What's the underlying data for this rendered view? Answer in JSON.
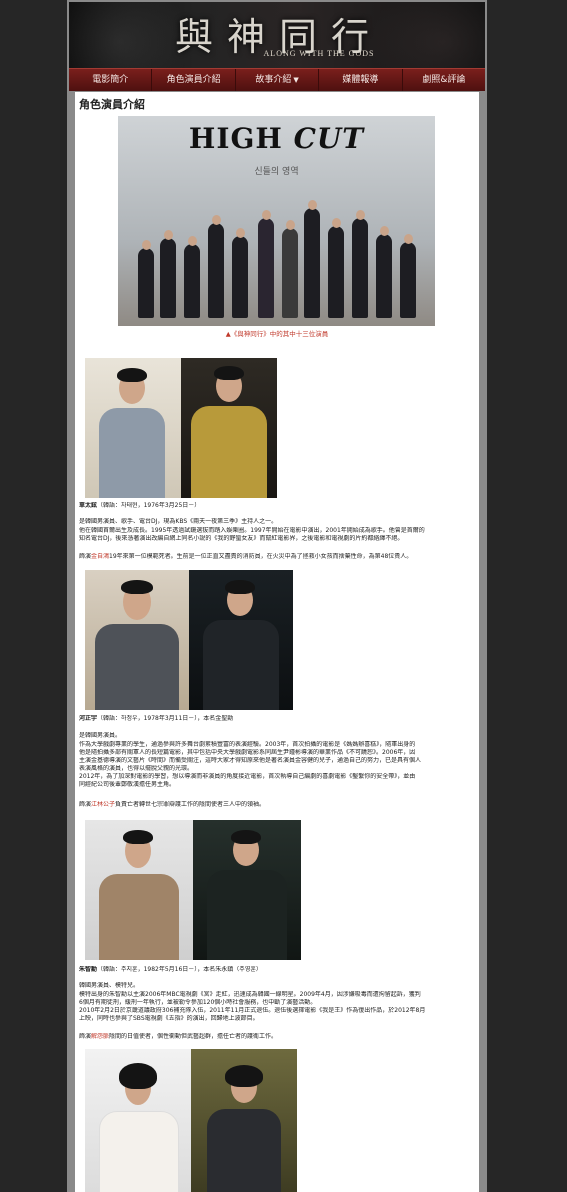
{
  "banner": {
    "title": "與神同行",
    "subtitle": "ALONG WITH THE GODS"
  },
  "nav": {
    "items": [
      {
        "label": "電影簡介"
      },
      {
        "label": "角色演員介紹"
      },
      {
        "label": "故事介紹",
        "has_dropdown": true
      },
      {
        "label": "媒體報導"
      },
      {
        "label": "劇照&評論"
      }
    ]
  },
  "page_title": "角色演員介紹",
  "hero": {
    "magazine_name_1": "HIGH",
    "magazine_name_2": "CUT",
    "magazine_tagline": "신들의 영역",
    "caption": "▲《與神同行》中的其中十三位演員"
  },
  "actors": [
    {
      "name": "車太鉉",
      "info": "（韓語：차태현，1976年3月25日－）",
      "intro": "是韓國男演員、歌手、電台DJ，現為KBS《兩天一夜第三季》主持人之一。",
      "bio_lines": [
        "他在韓國首爾出生及成長。1995年透過試鏡選拔而踏入娛樂圈。1997年開始在電影中演出，2001年開始成為歌手。他曾是首爾的",
        "知名電台DJ，後來憑著演出改編自網上同名小說的《我的野蠻女友》而竄紅電影界，之後電影和電視劇的片約都絡繹不絕。"
      ],
      "role_prefix": "飾演",
      "role_name": "金自鴻",
      "role_desc": "19年來第一位模範死者。生前是一位正直又盡責的消防員，在火災中為了拯救小女孩而捨棄性命，為第48位貴人。"
    },
    {
      "name": "河正宇",
      "info": "（韓語：하정우，1978年3月11日－），本名金聖勳",
      "intro": "是韓國男演員。",
      "bio_lines": [
        "作為大學戲劇專業的學生，通過參與許多舞台劇累積豐富的表演經驗。2003年，首次拍攝的電影是《媽媽辦喜糕》，隨軍出身的",
        "他是隨拍攝多部有關軍人的長短篇電影，其中包括中央大學戲劇電影系同屆生尹鍾彬導演的畢業作品《不可饒恕》。2006年，因",
        "主演金基德導演的文藝片《時間》而備受關注，這時大家才得知原來他是著名演員金容健的兒子，通過自己的努力，已是具有個人",
        "表演風格的演員，也得以擺脫父親的光環。",
        "2012年，為了加深對電影的學習，想以導演而非演員的角度接近電影，首次執導自己編劇的喜劇電影《鑿繫你的安全帶》，並由",
        "同經紀公司後輩鄭敬漢擔任男主角。"
      ],
      "role_prefix": "飾演",
      "role_name": "江林公子",
      "role_desc": "負責亡者轉世七宗罪辯護工作的陰間使者三人中的領袖。"
    },
    {
      "name": "朱智勳",
      "info": "（韓語：주지훈，1982年5月16日－），本名朱永鎮（주영훈）",
      "intro": "韓國男演員、模特兒。",
      "bio_lines": [
        "模特出身的朱智勳以主演2006年MBC電視劇《宮》走紅，迅速成為韓國一線明星。2009年4月，因涉嫌吸毒而遭拘留起訴，獲判",
        "6個月有期徒刑，緩刑一年執行，並被勒令參加120個小時社會服務，也中斷了演藝活動。",
        "2010年2月2日於京畿道議政府306補充隊入伍，2011年11月正式退伍。退伍後選擇電影《我是王》作為復出作品，於2012年8月",
        "上映，同時也參與了SBS電視劇《五指》的演出，回歸地上波節目。"
      ],
      "role_prefix": "飾演",
      "role_name": "解怨脈",
      "role_desc": "陰間的日值使者，個性衝動但武藝超群，擔任亡者的護衛工作。"
    }
  ]
}
